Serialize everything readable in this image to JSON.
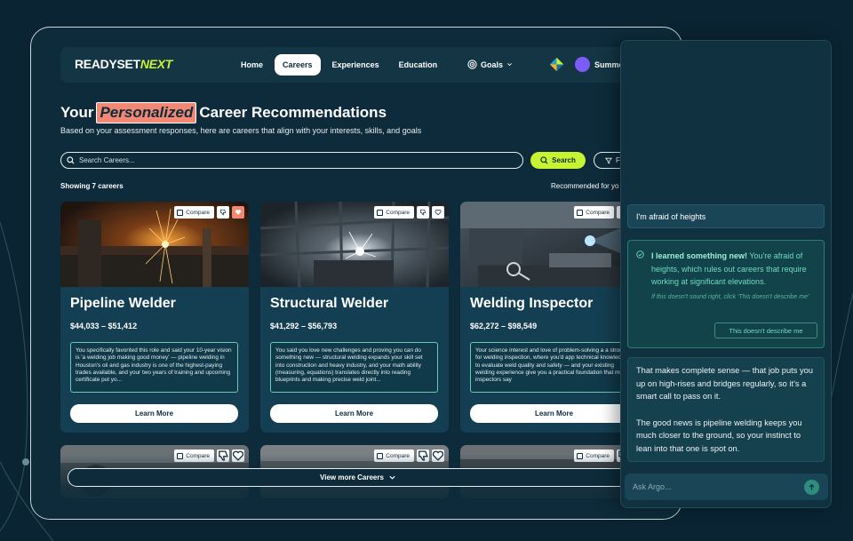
{
  "nav": {
    "logo_part1": "READYSET",
    "logo_part2": "NEXT",
    "links": [
      {
        "label": "Home",
        "active": false
      },
      {
        "label": "Careers",
        "active": true
      },
      {
        "label": "Experiences",
        "active": false
      },
      {
        "label": "Education",
        "active": false
      }
    ],
    "goals_label": "Goals",
    "user_name": "Summer Reeves"
  },
  "page": {
    "title_prefix": "Your",
    "title_highlight": "Personalized",
    "title_suffix": "Career Recommendations",
    "subtitle": "Based on your assessment responses, here are careers that align with your interests, skills, and goals"
  },
  "search": {
    "placeholder": "Search Careers...",
    "button_label": "Search",
    "filter_label": "Fi"
  },
  "results": {
    "count_label": "Showing 7 careers",
    "sort_label": "Recommended for yo"
  },
  "card_common": {
    "compare_label": "Compare",
    "learn_more_label": "Learn More"
  },
  "cards": [
    {
      "title": "Pipeline Welder",
      "salary": "$44,033 – $51,412",
      "description": "You specifically favorited this role and said your 10-year vision is 'a welding job making good money' — pipeline welding in Houston's oil and gas industry is one of the highest-paying trades available, and your two years of training and upcoming certificate put yo...",
      "favorited": true
    },
    {
      "title": "Structural Welder",
      "salary": "$41,292 – $56,793",
      "description": "You said you love new challenges and proving you can do something new — structural welding expands your skill set into construction and heavy industry, and your math ability (measuring, equations) translates directly into reading blueprints and making precise weld joint...",
      "favorited": false
    },
    {
      "title": "Welding Inspector",
      "salary": "$62,272 – $98,549",
      "description": "Your science interest and love of problem-solving a a strong fit for welding inspection, where you'd app technical knowledge to evaluate weld quality and safety — and your existing welding experience give you a practical foundation that most inspectors say",
      "favorited": false
    }
  ],
  "view_more_label": "View more Careers",
  "chat": {
    "user_message": "I'm afraid of heights",
    "learned_title": "I learned something new!",
    "learned_text": " You're afraid of heights, which rules out careers that require working at significant elevations.",
    "learned_note": "If this doesn't sound right, click 'This doesn't describe me'",
    "not_me_label": "This doesn't describe me",
    "bot_para1": "That makes complete sense — that job puts you up on high-rises and bridges regularly, so it's a smart call to pass on it.",
    "bot_para2": "The good news is pipeline welding keeps you much closer to the ground, so your instinct to lean into that one is spot on.",
    "input_placeholder": "Ask Argo..."
  },
  "colors": {
    "background": "#0a2433",
    "accent_lime": "#c6f432",
    "accent_coral": "#f28773",
    "teal": "#6fdcc0"
  }
}
